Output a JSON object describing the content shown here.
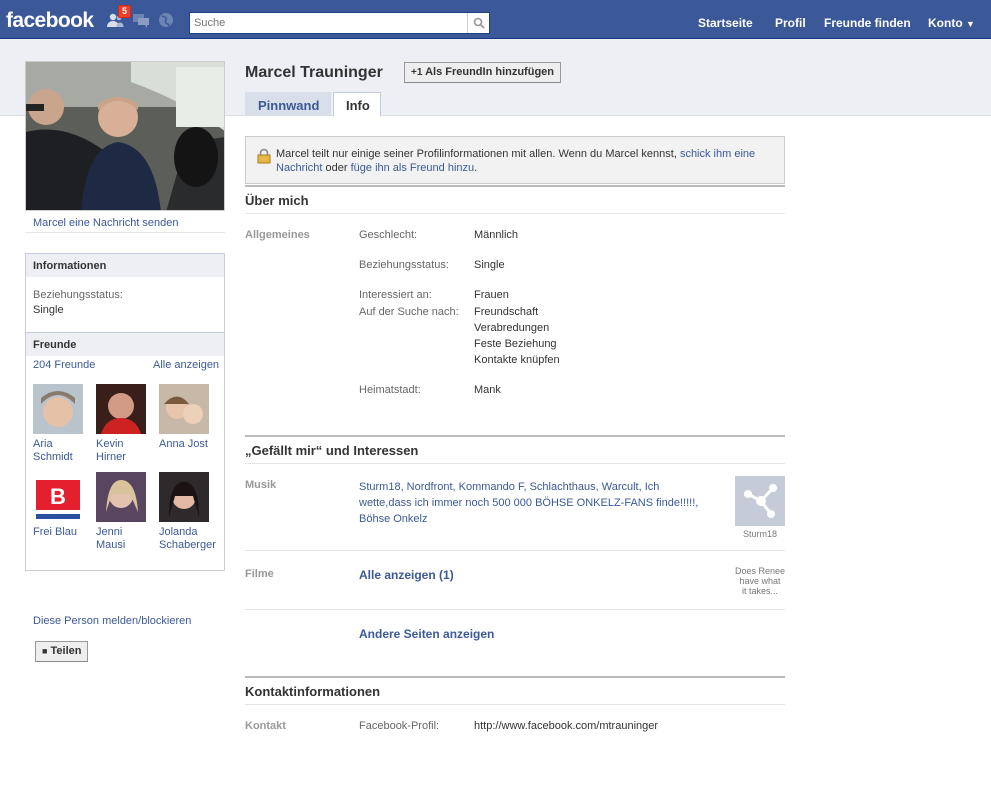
{
  "topbar": {
    "logo": "facebook",
    "friend_requests_badge": "5",
    "search_placeholder": "Suche",
    "nav": [
      "Startseite",
      "Profil",
      "Freunde finden",
      "Konto"
    ]
  },
  "left": {
    "send_message": "Marcel eine Nachricht senden",
    "info_header": "Informationen",
    "info_label": "Beziehungsstatus:",
    "info_value": "Single",
    "friends_header": "Freunde",
    "friends_count": "204 Freunde",
    "friends_all": "Alle anzeigen",
    "friends": [
      {
        "line1": "Aria",
        "line2": "Schmidt"
      },
      {
        "line1": "Kevin",
        "line2": "Hirner"
      },
      {
        "line1": "Anna Jost",
        "line2": ""
      },
      {
        "line1": "Frei Blau",
        "line2": ""
      },
      {
        "line1": "Jenni Mausi",
        "line2": ""
      },
      {
        "line1": "Jolanda",
        "line2": "Schaberger"
      }
    ],
    "report": "Diese Person melden/blockieren",
    "share": "Teilen"
  },
  "header": {
    "name": "Marcel Trauninger",
    "add_friend": "Als FreundIn hinzufügen",
    "tab_wall": "Pinnwand",
    "tab_info": "Info"
  },
  "notice": {
    "text1": "Marcel teilt nur einige seiner Profilinformationen mit allen. Wenn du Marcel kennst, ",
    "link1": "schick ihm eine Nachricht",
    "text2": " oder ",
    "link2": "füge ihn als Freund hinzu",
    "text3": "."
  },
  "about": {
    "title": "Über mich",
    "group": "Allgemeines",
    "gender_label": "Geschlecht:",
    "gender": "Männlich",
    "relationship_label": "Beziehungsstatus:",
    "relationship": "Single",
    "interested_label": "Interessiert an:",
    "interested": "Frauen",
    "looking_label": "Auf der Suche nach:",
    "looking": [
      "Freundschaft",
      "Verabredungen",
      "Feste Beziehung",
      "Kontakte knüpfen"
    ],
    "hometown_label": "Heimatstadt:",
    "hometown": "Mank"
  },
  "likes": {
    "title": "„Gefällt mir“ und Interessen",
    "music_label": "Musik",
    "music_line1": "Sturm18, Nordfront, Kommando F, Schlachthaus, Warcult, Ich",
    "music_line2": "wette,dass ich immer noch 500 000 BÖHSE ONKELZ-FANS finde!!!!!,",
    "music_line3": "Böhse Onkelz",
    "music_thumb_caption": "Sturm18",
    "films_label": "Filme",
    "films_all": "Alle anzeigen (1)",
    "films_thumb_line1": "Does Renee",
    "films_thumb_line2": "have what",
    "films_thumb_line3": "it takes...",
    "other_pages": "Andere Seiten anzeigen"
  },
  "contact": {
    "title": "Kontaktinformationen",
    "label": "Kontakt",
    "fb_label": "Facebook-Profil:",
    "fb_value": "http://www.facebook.com/mtrauninger"
  },
  "colors": {
    "brand": "#3b5998",
    "badge": "#f03d25"
  }
}
